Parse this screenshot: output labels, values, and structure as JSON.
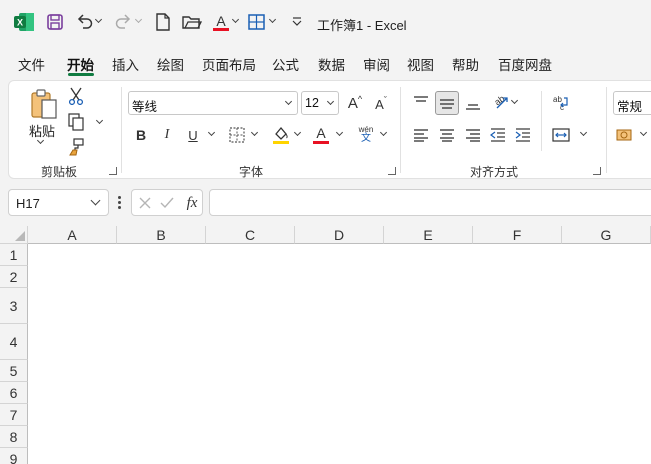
{
  "window": {
    "title": "工作簿1  -  Excel"
  },
  "tabs": [
    "文件",
    "开始",
    "插入",
    "绘图",
    "页面布局",
    "公式",
    "数据",
    "审阅",
    "视图",
    "帮助",
    "百度网盘"
  ],
  "active_tab": "开始",
  "ribbon": {
    "clipboard": {
      "paste_label": "粘贴",
      "group_label": "剪贴板"
    },
    "font": {
      "font_name": "等线",
      "font_size": "12",
      "group_label": "字体",
      "phonetic_top": "wén",
      "phonetic_bottom": "文",
      "bold": "B",
      "italic": "I",
      "underline": "U",
      "grow": "A",
      "shrink": "A",
      "color_letter": "A"
    },
    "alignment": {
      "group_label": "对齐方式"
    },
    "number": {
      "format": "常规"
    }
  },
  "formula_bar": {
    "name_box": "H17",
    "fx_label": "fx",
    "formula": ""
  },
  "grid": {
    "columns": [
      "A",
      "B",
      "C",
      "D",
      "E",
      "F",
      "G"
    ],
    "rows": [
      "1",
      "2",
      "3",
      "4",
      "5",
      "6",
      "7",
      "8",
      "9"
    ]
  },
  "colors": {
    "accent": "#107c41",
    "font_color": "#e81123",
    "highlight": "#ffd400"
  }
}
